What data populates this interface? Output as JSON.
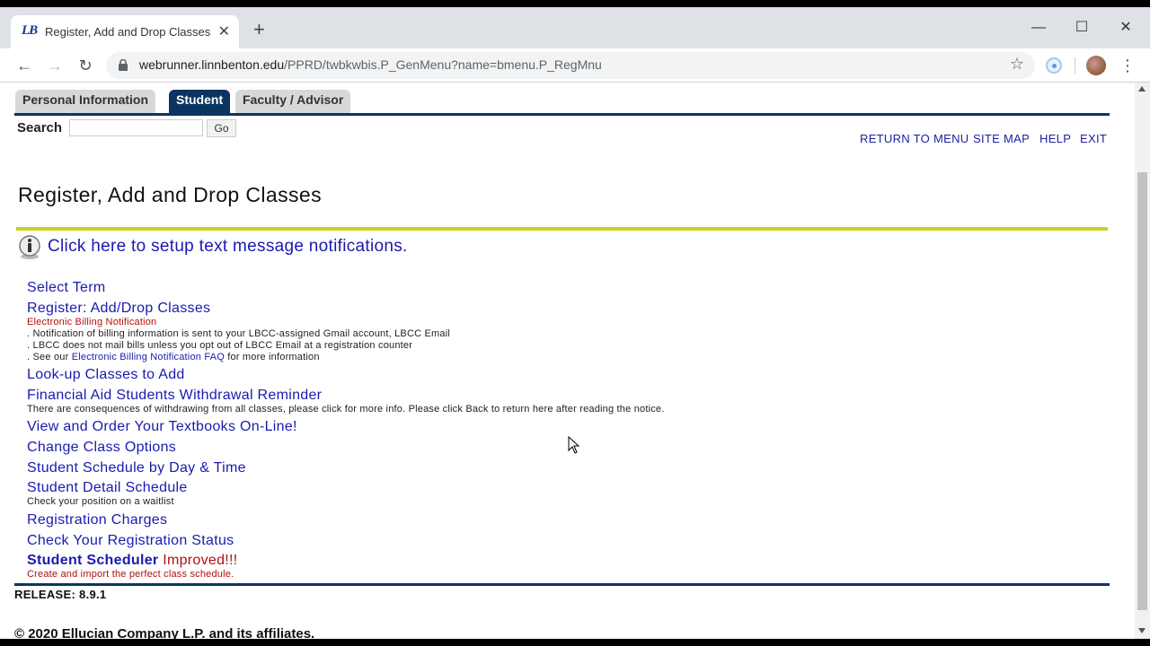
{
  "browser": {
    "tab_title": "Register, Add and Drop Classes",
    "tab_favicon_text": "LB",
    "url_host": "webrunner.linnbenton.edu",
    "url_path": "/PPRD/twbkwbis.P_GenMenu?name=bmenu.P_RegMnu"
  },
  "nav_tabs": [
    {
      "label": "Personal Information"
    },
    {
      "label": "Student"
    },
    {
      "label": "Faculty / Advisor"
    }
  ],
  "search": {
    "label": "Search",
    "value": "",
    "button": "Go"
  },
  "top_links": {
    "return_to_menu": "RETURN TO MENU",
    "site_map": "SITE MAP",
    "help": "HELP",
    "exit": "EXIT"
  },
  "page_title": "Register, Add and Drop Classes",
  "sms_link": "Click here to setup text message notifications.",
  "menu": {
    "select_term": "Select Term",
    "register": "Register: Add/Drop Classes",
    "billing_title": "Electronic Billing Notification",
    "billing_line1": ". Notification of billing information is sent to your LBCC-assigned Gmail account, LBCC Email",
    "billing_line2": ". LBCC does not mail bills unless you opt out of LBCC Email at a registration counter",
    "billing_line3_prefix": ". See our",
    "billing_line3_link": "Electronic Billing Notification FAQ",
    "billing_line3_suffix": "for more information",
    "lookup": "Look-up Classes to Add",
    "fa_withdrawal": "Financial Aid Students Withdrawal Reminder",
    "fa_note": "There are consequences of withdrawing from all classes, please click for more info. Please click Back to return here after reading the notice.",
    "textbooks": "View and Order Your Textbooks On-Line!",
    "change_options": "Change Class Options",
    "schedule_day_time": "Student Schedule by Day & Time",
    "detail_schedule": "Student Detail Schedule",
    "waitlist_note": "Check your position on a waitlist",
    "charges": "Registration Charges",
    "reg_status": "Check Your Registration Status",
    "scheduler": "Student Scheduler",
    "scheduler_improved": "Improved!!!",
    "scheduler_note": "Create and import the perfect class schedule."
  },
  "footer": {
    "release": "RELEASE: 8.9.1",
    "copyright": "© 2020 Ellucian Company L.P. and its affiliates."
  },
  "colors": {
    "nav_blue": "#0b3561",
    "link_blue": "#1a1ab0",
    "accent_yellow": "#c8d21e",
    "note_red": "#b01010"
  }
}
